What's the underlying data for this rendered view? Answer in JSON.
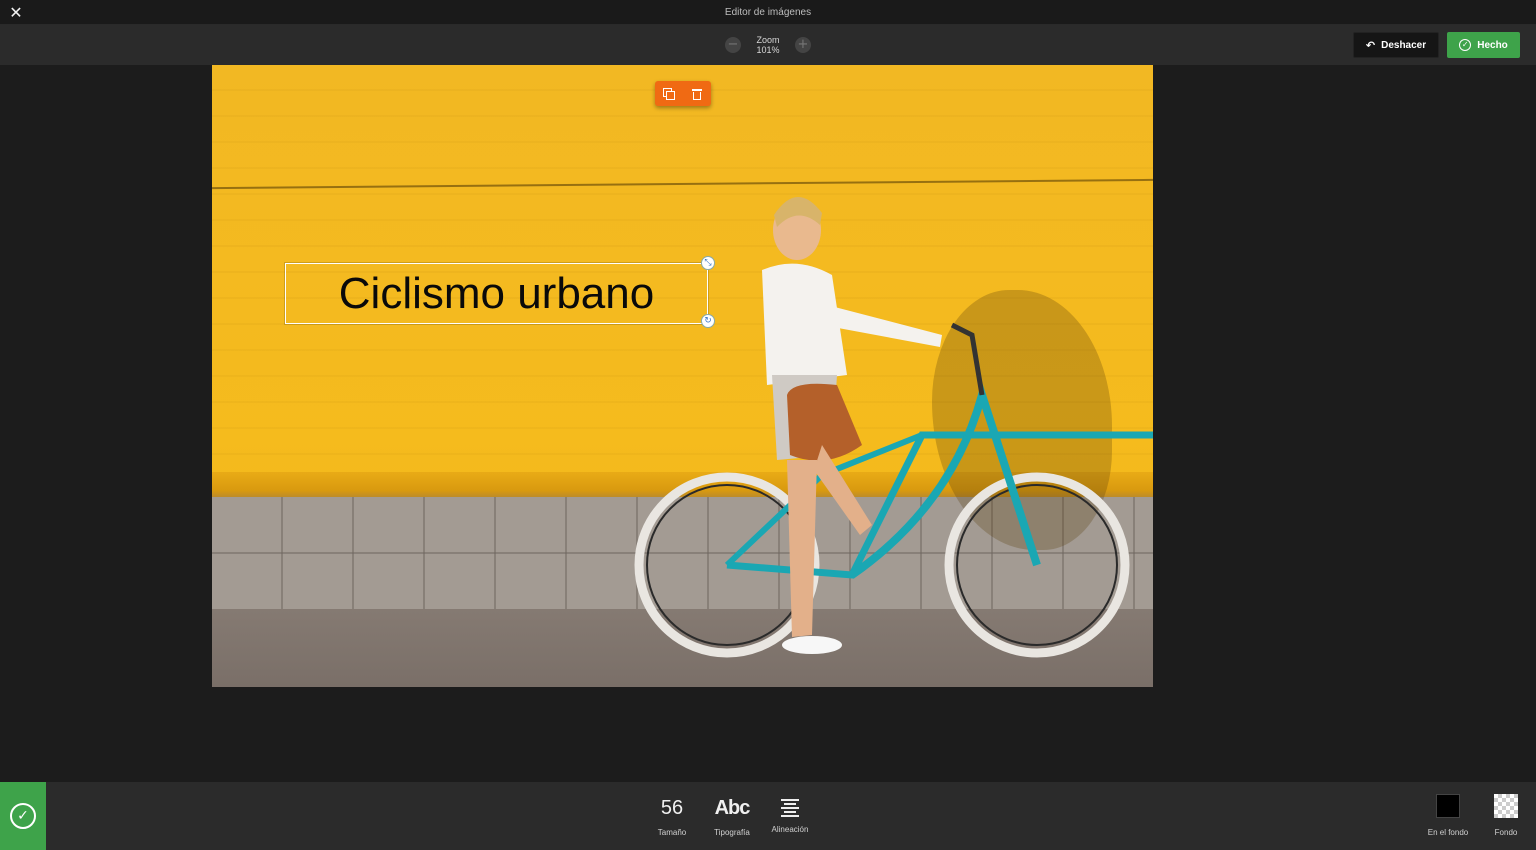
{
  "window": {
    "title": "Editor de imágenes",
    "close_glyph": "✕"
  },
  "toolbar": {
    "zoom_label": "Zoom",
    "zoom_value": "101%",
    "zoom_out_glyph": "−",
    "zoom_in_glyph": "+",
    "undo_label": "Deshacer",
    "done_label": "Hecho",
    "undo_glyph": "↶",
    "check_glyph": "✓"
  },
  "canvas": {
    "text_layer": {
      "text": "Ciclismo urbano",
      "font_size": 56,
      "color": "#000000"
    },
    "actions": {
      "duplicate_icon": "duplicate-icon",
      "delete_icon": "trash-icon"
    },
    "handles": {
      "resize_glyph": "⤡",
      "rotate_glyph": "↻"
    }
  },
  "bottom": {
    "confirm_glyph": "✓",
    "size_value": "56",
    "size_label": "Tamaño",
    "font_value": "Abc",
    "font_label": "Tipografía",
    "align_label": "Alineación",
    "foreground_label": "En el fondo",
    "background_label": "Fondo"
  },
  "colors": {
    "accent_green": "#3ea34a",
    "accent_orange": "#f06a13",
    "panel": "#2b2b2b",
    "canvas_bg": "#1c1c1c"
  }
}
